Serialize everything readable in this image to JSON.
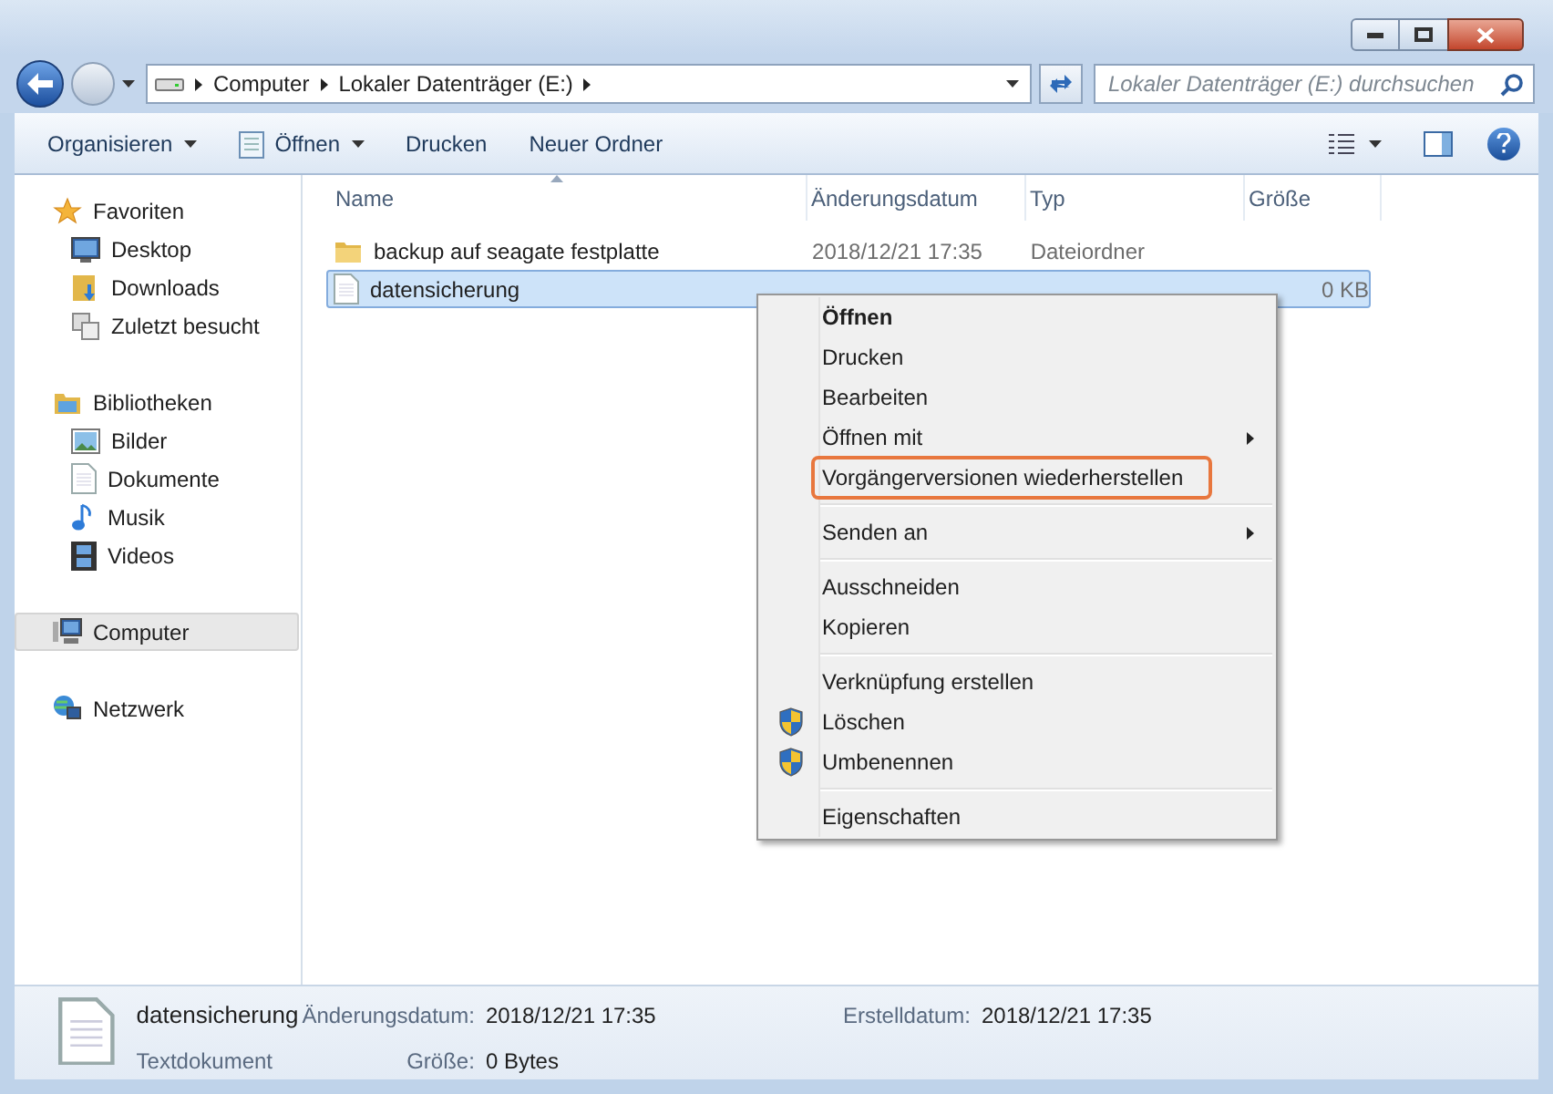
{
  "address_bar": {
    "path": [
      "Computer",
      "Lokaler Datenträger (E:)"
    ]
  },
  "search": {
    "placeholder": "Lokaler Datenträger (E:) durchsuchen"
  },
  "toolbar": {
    "buttons": [
      {
        "label": "Organisieren",
        "kind": "dropdown"
      },
      {
        "label": "Öffnen",
        "kind": "icon-dropdown"
      },
      {
        "label": "Drucken",
        "kind": "plain"
      },
      {
        "label": "Neuer Ordner",
        "kind": "plain"
      }
    ]
  },
  "sidebar": {
    "groups": [
      {
        "label": "Favoriten",
        "selected": false,
        "children": [
          {
            "label": "Desktop",
            "selected": false
          },
          {
            "label": "Downloads",
            "selected": false
          },
          {
            "label": "Zuletzt besucht",
            "selected": false
          }
        ]
      },
      {
        "label": "Bibliotheken",
        "selected": false,
        "children": [
          {
            "label": "Bilder",
            "selected": false
          },
          {
            "label": "Dokumente",
            "selected": false
          },
          {
            "label": "Musik",
            "selected": false
          },
          {
            "label": "Videos",
            "selected": false
          }
        ]
      },
      {
        "label": "Computer",
        "selected": true
      },
      {
        "label": "Netzwerk",
        "selected": false
      }
    ]
  },
  "table": {
    "columns": [
      {
        "label": "Name",
        "sorted": true
      },
      {
        "label": "Änderungsdatum",
        "sorted": false
      },
      {
        "label": "Typ",
        "sorted": false
      },
      {
        "label": "Größe",
        "sorted": false
      }
    ],
    "rows": [
      {
        "kind": "folder",
        "name": "backup auf seagate festplatte",
        "date": "2018/12/21 17:35",
        "type": "Dateiordner",
        "selected": false
      },
      {
        "kind": "text",
        "name": "datensicherung",
        "size": "0 KB",
        "selected": true
      }
    ]
  },
  "context_menu": {
    "groups": [
      [
        {
          "label": "Öffnen",
          "bold": true,
          "submenu": false,
          "shield": false,
          "highlighted": false
        },
        {
          "label": "Drucken",
          "bold": false,
          "submenu": false,
          "shield": false,
          "highlighted": false
        },
        {
          "label": "Bearbeiten",
          "bold": false,
          "submenu": false,
          "shield": false,
          "highlighted": false
        },
        {
          "label": "Öffnen mit",
          "bold": false,
          "submenu": true,
          "shield": false,
          "highlighted": false
        },
        {
          "label": "Vorgängerversionen wiederherstellen",
          "bold": false,
          "submenu": false,
          "shield": false,
          "highlighted": true
        }
      ],
      [
        {
          "label": "Senden an",
          "bold": false,
          "submenu": true,
          "shield": false,
          "highlighted": false
        }
      ],
      [
        {
          "label": "Ausschneiden",
          "bold": false,
          "submenu": false,
          "shield": false,
          "highlighted": false
        },
        {
          "label": "Kopieren",
          "bold": false,
          "submenu": false,
          "shield": false,
          "highlighted": false
        }
      ],
      [
        {
          "label": "Verknüpfung erstellen",
          "bold": false,
          "submenu": false,
          "shield": false,
          "highlighted": false
        },
        {
          "label": "Löschen",
          "bold": false,
          "submenu": false,
          "shield": true,
          "highlighted": false
        },
        {
          "label": "Umbenennen",
          "bold": false,
          "submenu": false,
          "shield": true,
          "highlighted": false
        }
      ],
      [
        {
          "label": "Eigenschaften",
          "bold": false,
          "submenu": false,
          "shield": false,
          "highlighted": false
        }
      ]
    ]
  },
  "details": {
    "name": "datensicherung",
    "type": "Textdokument",
    "fields": [
      {
        "label": "Änderungsdatum:",
        "value": "2018/12/21 17:35"
      },
      {
        "label": "Größe:",
        "value": "0 Bytes"
      },
      {
        "label": "Erstelldatum:",
        "value": "2018/12/21 17:35"
      }
    ]
  }
}
